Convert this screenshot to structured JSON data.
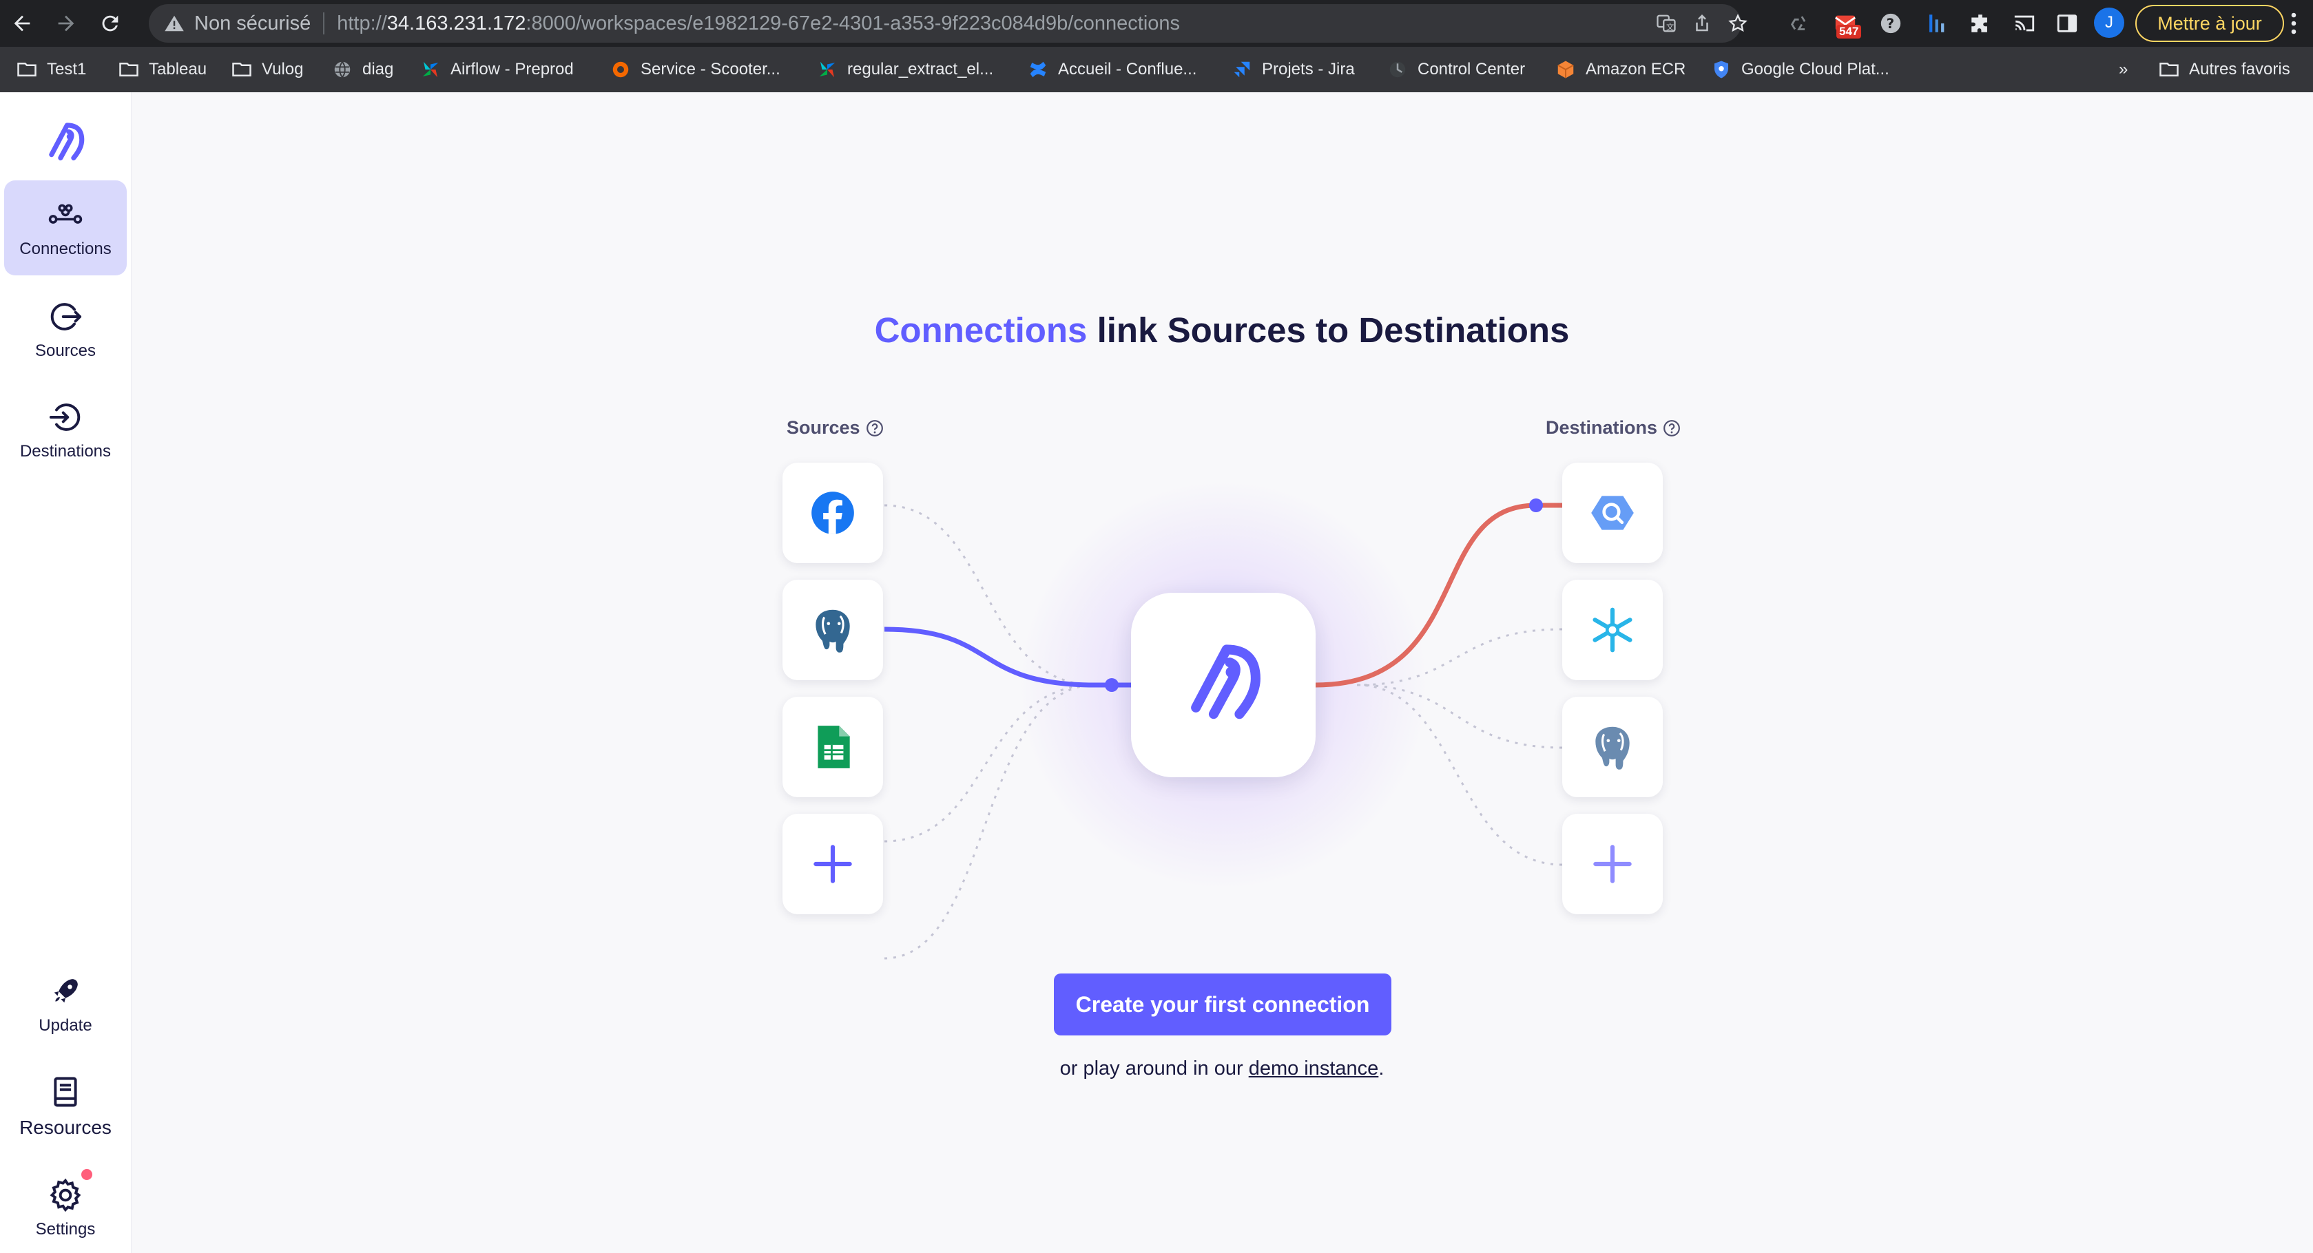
{
  "browser": {
    "omnibox": {
      "insecure_label": "Non sécurisé",
      "url_scheme": "http://",
      "url_host": "34.163.231.172",
      "url_rest": ":8000/workspaces/e1982129-67e2-4301-a353-9f223c084d9b/connections"
    },
    "mail_badge": "547",
    "avatar_letter": "J",
    "update_label": "Mettre à jour",
    "bookmarks": [
      {
        "label": "Test1",
        "icon": "folder-icon"
      },
      {
        "label": "Tableau",
        "icon": "folder-icon"
      },
      {
        "label": "Vulog",
        "icon": "folder-icon"
      },
      {
        "label": "diag",
        "icon": "globe-icon"
      },
      {
        "label": "Airflow - Preprod",
        "icon": "airflow-icon"
      },
      {
        "label": "Service - Scooter...",
        "icon": "grafana-icon"
      },
      {
        "label": "regular_extract_el...",
        "icon": "airflow-icon"
      },
      {
        "label": "Accueil - Conflue...",
        "icon": "confluence-icon"
      },
      {
        "label": "Projets - Jira",
        "icon": "jira-icon"
      },
      {
        "label": "Control Center",
        "icon": "control-center-icon"
      },
      {
        "label": "Amazon ECR",
        "icon": "aws-icon"
      },
      {
        "label": "Google Cloud Plat...",
        "icon": "gcp-icon"
      }
    ],
    "bookmarks_overflow": "»",
    "other_bookmarks": "Autres favoris"
  },
  "sidebar": {
    "items": [
      {
        "label": "Connections",
        "active": true
      },
      {
        "label": "Sources"
      },
      {
        "label": "Destinations"
      }
    ],
    "bottom_items": [
      {
        "label": "Update"
      },
      {
        "label": "Resources"
      },
      {
        "label": "Settings"
      }
    ]
  },
  "main": {
    "headline_accent": "Connections",
    "headline_rest": " link Sources to Destinations",
    "sources_label": "Sources",
    "destinations_label": "Destinations",
    "sources": [
      "facebook-icon",
      "postgres-icon",
      "google-sheets-icon",
      "plus-icon"
    ],
    "destinations": [
      "bigquery-icon",
      "snowflake-icon",
      "postgres-icon",
      "plus-icon"
    ],
    "cta_label": "Create your first connection",
    "demo_prefix": "or play around in our ",
    "demo_link": "demo instance",
    "demo_suffix": "."
  },
  "colors": {
    "accent": "#615eff",
    "active_nav_bg": "#d9d9fc",
    "destination_line": "#e06a60",
    "notification_dot": "#ff5e7b"
  }
}
